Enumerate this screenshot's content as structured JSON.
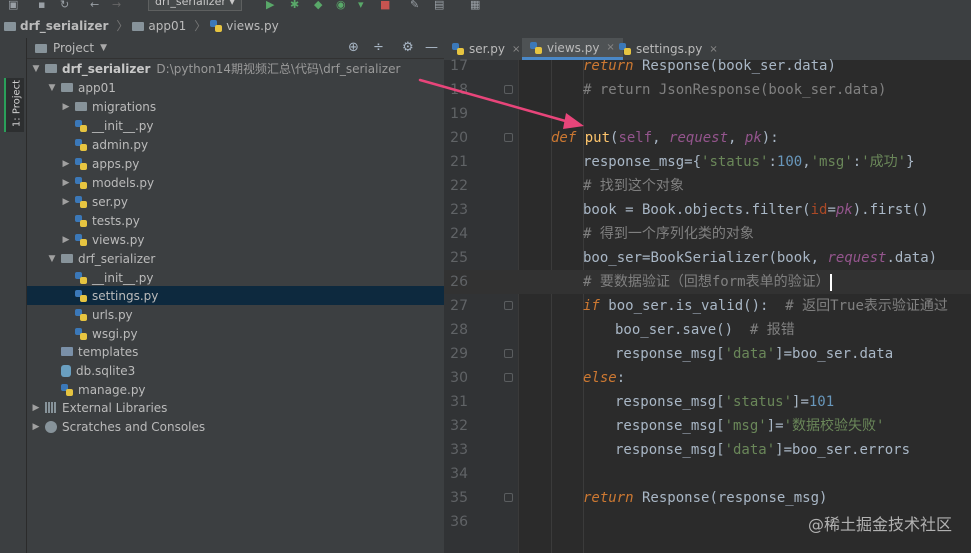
{
  "toolbar": {
    "run_config": "drf_serializer"
  },
  "breadcrumb": {
    "root": "drf_serializer",
    "folder": "app01",
    "file": "views.py"
  },
  "side_tab": {
    "label": "1: Project"
  },
  "project_panel": {
    "title": "Project",
    "tree": [
      {
        "label": "drf_serializer",
        "path": "D:\\python14期视频汇总\\代码\\drf_serializer",
        "type": "folder",
        "expanded": true
      },
      {
        "label": "app01",
        "type": "folder",
        "expanded": true
      },
      {
        "label": "migrations",
        "type": "folder",
        "expanded": false
      },
      {
        "label": "__init__.py",
        "type": "py"
      },
      {
        "label": "admin.py",
        "type": "py"
      },
      {
        "label": "apps.py",
        "type": "py",
        "expanded": false
      },
      {
        "label": "models.py",
        "type": "py",
        "expanded": false
      },
      {
        "label": "ser.py",
        "type": "py",
        "expanded": false
      },
      {
        "label": "tests.py",
        "type": "py"
      },
      {
        "label": "views.py",
        "type": "py",
        "expanded": false
      },
      {
        "label": "drf_serializer",
        "type": "folder",
        "expanded": true
      },
      {
        "label": "__init__.py",
        "type": "py"
      },
      {
        "label": "settings.py",
        "type": "py",
        "selected": true
      },
      {
        "label": "urls.py",
        "type": "py"
      },
      {
        "label": "wsgi.py",
        "type": "py"
      },
      {
        "label": "templates",
        "type": "folder"
      },
      {
        "label": "db.sqlite3",
        "type": "db"
      },
      {
        "label": "manage.py",
        "type": "py"
      },
      {
        "label": "External Libraries",
        "type": "lib",
        "expanded": false
      },
      {
        "label": "Scratches and Consoles",
        "type": "scratch",
        "expanded": false
      }
    ]
  },
  "tabs": [
    {
      "label": "ser.py"
    },
    {
      "label": "views.py",
      "active": true
    },
    {
      "label": "settings.py"
    }
  ],
  "code": {
    "l17": {
      "num": "17",
      "a": "return",
      "b": " Response",
      "c": "(book_ser.data)"
    },
    "l18": {
      "num": "18",
      "a": "# return JsonResponse(book_ser.data)"
    },
    "l19": {
      "num": "19"
    },
    "l20": {
      "num": "20",
      "a": "def",
      "b": " put",
      "c": "(",
      "d": "self",
      "e": ", ",
      "f": "request",
      "g": ", ",
      "h": "pk",
      "i": "):"
    },
    "l21": {
      "num": "21",
      "a": "response_msg={",
      "b": "'status'",
      "c": ":",
      "d": "100",
      "e": ",",
      "f": "'msg'",
      "g": ":",
      "h": "'成功'",
      "i": "}"
    },
    "l22": {
      "num": "22",
      "a": "# 找到这个对象"
    },
    "l23": {
      "num": "23",
      "a": "book = Book.objects.filter(",
      "b": "id",
      "c": "=",
      "d": "pk",
      "e": ").first()"
    },
    "l24": {
      "num": "24",
      "a": "# 得到一个序列化类的对象"
    },
    "l25": {
      "num": "25",
      "a": "boo_ser=",
      "b": "BookSerializer",
      "c": "(book, ",
      "d": "request",
      "e": ".data)"
    },
    "l26": {
      "num": "26",
      "a": "# 要数据验证（回想form表单的验证）"
    },
    "l27": {
      "num": "27",
      "a": "if",
      "b": " boo_ser.is_valid():",
      "c": "  # 返回True表示验证通过"
    },
    "l28": {
      "num": "28",
      "a": "boo_ser.save()",
      "b": "  # 报错"
    },
    "l29": {
      "num": "29",
      "a": "response_msg[",
      "b": "'data'",
      "c": "]=boo_ser.data"
    },
    "l30": {
      "num": "30",
      "a": "else",
      "b": ":"
    },
    "l31": {
      "num": "31",
      "a": "response_msg[",
      "b": "'status'",
      "c": "]=",
      "d": "101"
    },
    "l32": {
      "num": "32",
      "a": "response_msg[",
      "b": "'msg'",
      "c": "]=",
      "d": "'数据校验失败'"
    },
    "l33": {
      "num": "33",
      "a": "response_msg[",
      "b": "'data'",
      "c": "]=boo_ser.errors"
    },
    "l34": {
      "num": "34"
    },
    "l35": {
      "num": "35",
      "a": "return",
      "b": " Response",
      "c": "(response_msg)"
    },
    "l36": {
      "num": "36"
    }
  },
  "watermark": "@稀土掘金技术社区",
  "colors": {
    "annotation_arrow": "#e8457a",
    "selection": "#0d293e",
    "tab_accent": "#4a88c7"
  }
}
